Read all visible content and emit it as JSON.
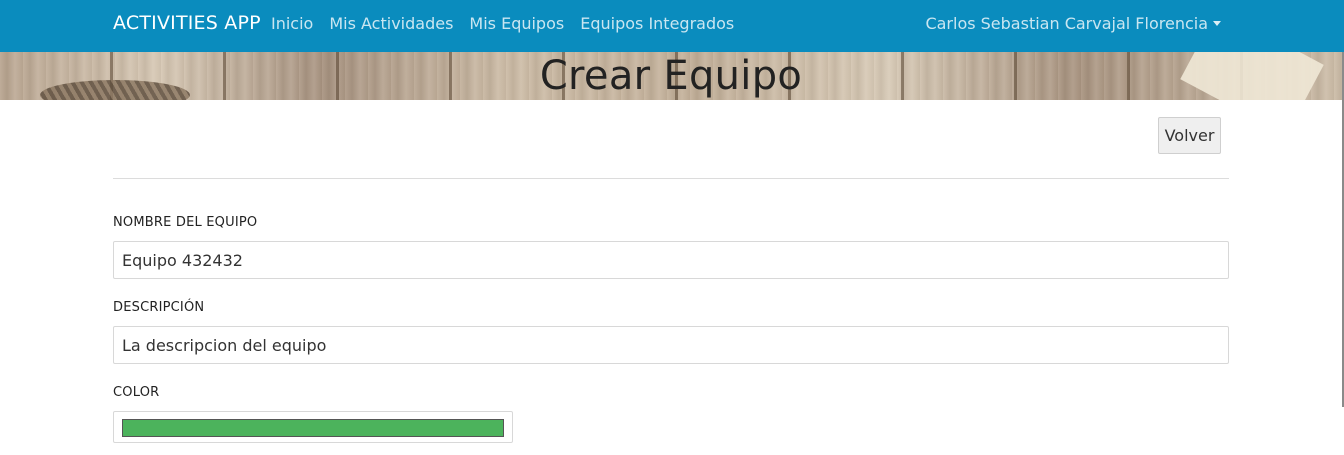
{
  "navbar": {
    "brand": "ACTIVITIES APP",
    "links": [
      "Inicio",
      "Mis Actividades",
      "Mis Equipos",
      "Equipos Integrados"
    ],
    "user": "Carlos Sebastian Carvajal Florencia",
    "bg_color": "#0a8cbe"
  },
  "banner": {
    "title": "Crear Equipo"
  },
  "toolbar": {
    "back_label": "Volver"
  },
  "form": {
    "name_label": "NOMBRE DEL EQUIPO",
    "name_value": "Equipo  432432",
    "description_label": "DESCRIPCIÓN",
    "description_value": "La descripcion del equipo",
    "color_label": "COLOR",
    "color_value": "#4cb35c"
  }
}
